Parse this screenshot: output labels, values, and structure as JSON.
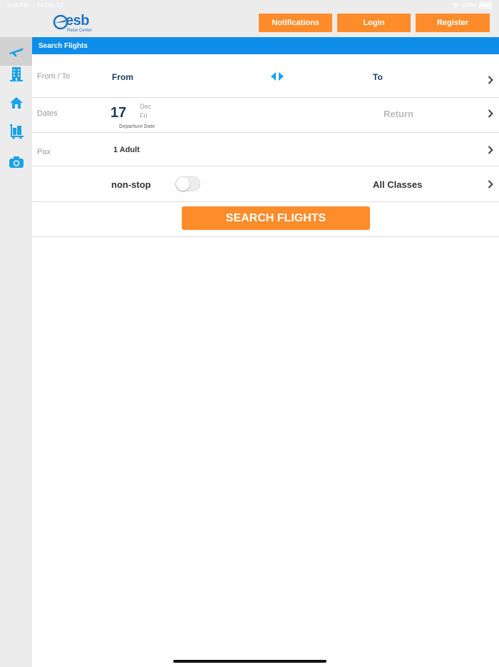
{
  "status_bar": {
    "time": "9:03 PM",
    "date": "Fri Dec 17",
    "battery": "100%"
  },
  "header": {
    "logo_text": "esb",
    "logo_subtitle": "Reise Center",
    "buttons": {
      "notifications": "Notifications",
      "login": "Login",
      "register": "Register"
    }
  },
  "sidebar": {
    "items": [
      {
        "icon": "airplane-icon",
        "active": true
      },
      {
        "icon": "hotel-building-icon",
        "active": false
      },
      {
        "icon": "home-icon",
        "active": false
      },
      {
        "icon": "luggage-cart-icon",
        "active": false
      },
      {
        "icon": "camera-icon",
        "active": false
      }
    ]
  },
  "section": {
    "title": "Search Flights"
  },
  "form": {
    "from_to": {
      "label": "From / To",
      "from": "From",
      "to": "To"
    },
    "dates": {
      "label": "Dates",
      "day": "17",
      "month": "Dec",
      "weekday": "Fri",
      "departure_label": "Departure Date",
      "return": "Return"
    },
    "pax": {
      "label": "Pax",
      "value": "1 Adult"
    },
    "options": {
      "nonstop_label": "non-stop",
      "nonstop_enabled": false,
      "classes": "All Classes"
    },
    "search_button": "SEARCH FLIGHTS"
  },
  "colors": {
    "accent_orange": "#ff8c2a",
    "header_blue": "#0e8ee9",
    "icon_blue": "#1aa3e8",
    "navy_text": "#1b3a5c",
    "sidebar_bg": "#ececec"
  }
}
